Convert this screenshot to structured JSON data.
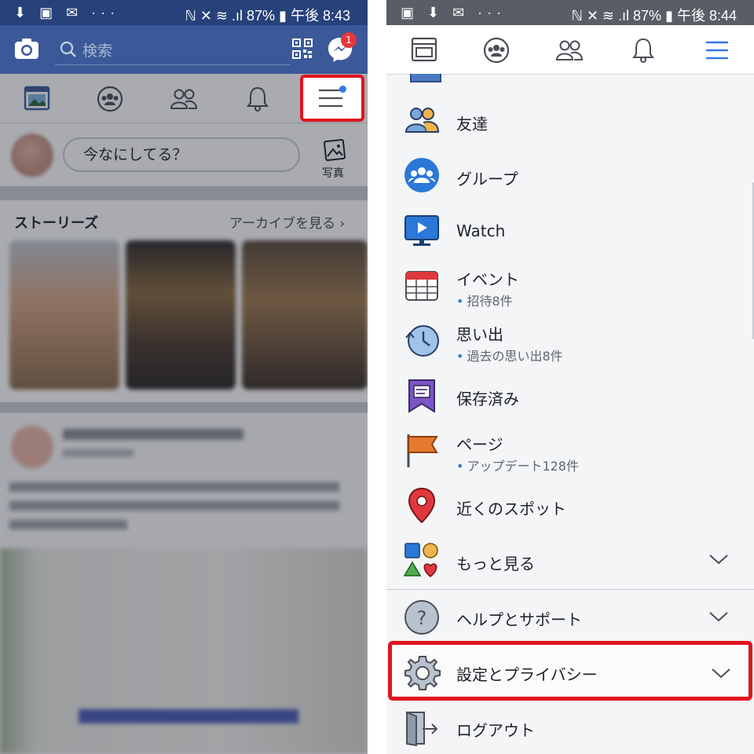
{
  "left": {
    "status_bar": {
      "left_icons": "⬇ ▣ ✉ ···",
      "right_text": "ℕ ✕ ≋ .ıl 87% ▮ 午後 8:43"
    },
    "top_bar": {
      "search_placeholder": "検索",
      "messenger_badge": "1"
    },
    "composer": {
      "placeholder": "今なにしてる？",
      "photo_label": "写真"
    },
    "stories": {
      "title": "ストーリーズ",
      "archive_link": "アーカイブを見る ›"
    }
  },
  "right": {
    "status_bar": {
      "left_icons": "▣ ⬇ ✉ ···",
      "right_text": "ℕ ✕ ≋ .ıl 87% ▮ 午後 8:44"
    },
    "menu": [
      {
        "label": "友達",
        "icon": "friends-icon"
      },
      {
        "label": "グループ",
        "icon": "groups-icon"
      },
      {
        "label": "Watch",
        "icon": "watch-icon"
      },
      {
        "label": "イベント",
        "sub": "招待8件",
        "icon": "calendar-icon"
      },
      {
        "label": "思い出",
        "sub": "過去の思い出8件",
        "icon": "memories-icon"
      },
      {
        "label": "保存済み",
        "icon": "saved-icon"
      },
      {
        "label": "ページ",
        "sub": "アップデート128件",
        "icon": "flag-icon"
      },
      {
        "label": "近くのスポット",
        "icon": "location-pin-icon"
      },
      {
        "label": "もっと見る",
        "icon": "shapes-icon"
      },
      {
        "label": "ヘルプとサポート",
        "icon": "help-icon"
      },
      {
        "label": "設定とプライバシー",
        "icon": "gear-icon"
      },
      {
        "label": "ログアウト",
        "icon": "logout-icon"
      }
    ]
  },
  "colors": {
    "facebook_blue": "#3b5998",
    "highlight_red": "#e0141e",
    "dot_blue": "#3578e5"
  }
}
